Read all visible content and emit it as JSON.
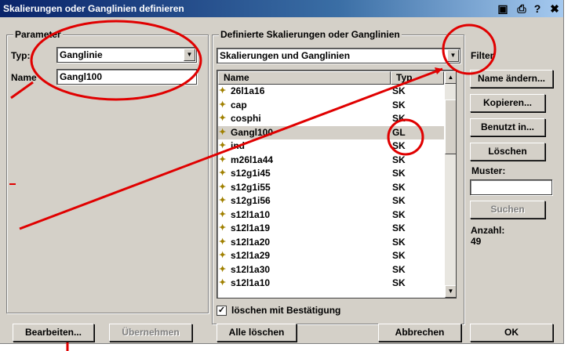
{
  "window": {
    "title": "Skalierungen oder Ganglinien definieren"
  },
  "params": {
    "group_label": "Parameter",
    "typ_label": "Typ:",
    "typ_value": "Ganglinie",
    "name_label": "Name",
    "name_value": "Gangl100"
  },
  "defined": {
    "group_label": "Definierte Skalierungen oder Ganglinien",
    "filter_value": "Skalierungen und Ganglinien",
    "filter_label": "Filter",
    "columns": {
      "name": "Name",
      "type": "Typ"
    },
    "rows": [
      {
        "name": "26l1a16",
        "type": "SK"
      },
      {
        "name": "cap",
        "type": "SK"
      },
      {
        "name": "cosphi",
        "type": "SK"
      },
      {
        "name": "Gangl100",
        "type": "GL"
      },
      {
        "name": "ind",
        "type": "SK"
      },
      {
        "name": "m26l1a44",
        "type": "SK"
      },
      {
        "name": "s12g1i45",
        "type": "SK"
      },
      {
        "name": "s12g1i55",
        "type": "SK"
      },
      {
        "name": "s12g1i56",
        "type": "SK"
      },
      {
        "name": "s12l1a10",
        "type": "SK"
      },
      {
        "name": "s12l1a19",
        "type": "SK"
      },
      {
        "name": "s12l1a20",
        "type": "SK"
      },
      {
        "name": "s12l1a29",
        "type": "SK"
      },
      {
        "name": "s12l1a30",
        "type": "SK"
      },
      {
        "name": "s12l1a10",
        "type": "SK"
      }
    ],
    "confirm_delete_label": "löschen mit Bestätigung"
  },
  "side": {
    "rename": "Name ändern...",
    "copy": "Kopieren...",
    "used_in": "Benutzt in...",
    "delete": "Löschen",
    "pattern_label": "Muster:",
    "pattern_value": "",
    "search": "Suchen",
    "count_label": "Anzahl:",
    "count_value": "49"
  },
  "buttons": {
    "edit": "Bearbeiten...",
    "apply": "Übernehmen",
    "delete_all": "Alle löschen",
    "cancel": "Abbrechen",
    "ok": "OK"
  },
  "icons": [
    "save-icon",
    "print-icon",
    "help-icon",
    "close-icon",
    "scale-item-icon"
  ],
  "colors": {
    "title_start": "#0a246a",
    "title_end": "#a6caf0",
    "dialog_bg": "#d4d0c8",
    "annotation": "#e00000"
  }
}
